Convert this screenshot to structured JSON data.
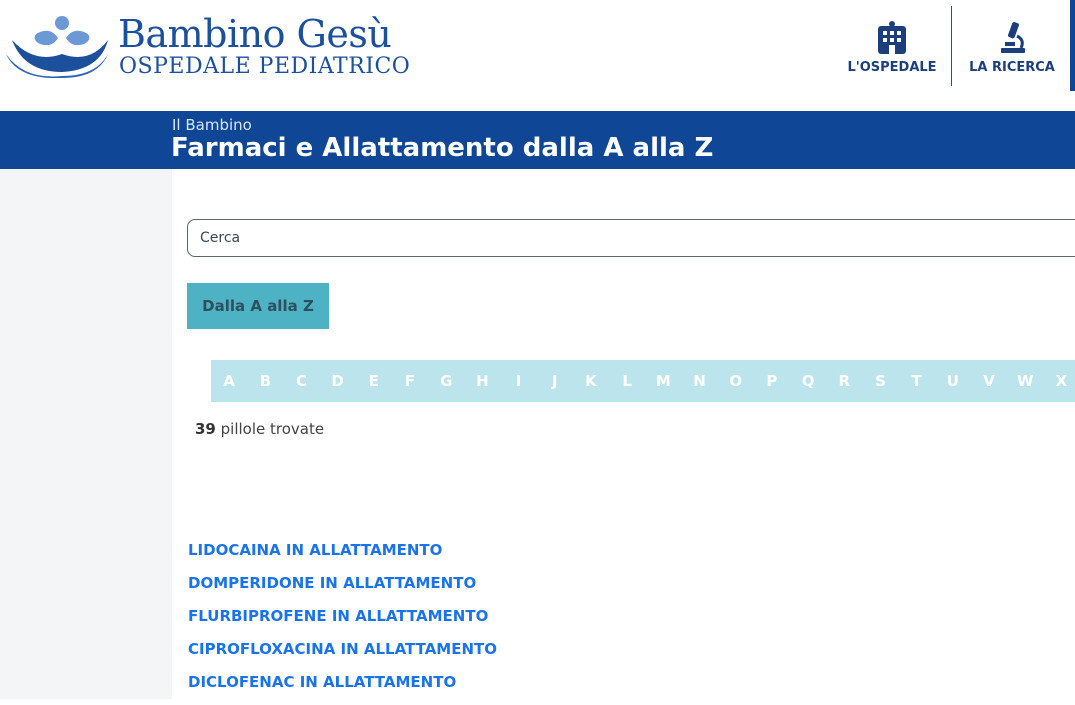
{
  "logo": {
    "title": "Bambino Gesù",
    "subtitle": "OSPEDALE PEDIATRICO",
    "icon": "bambino-gesu-emblem"
  },
  "nav": {
    "hospital": {
      "label": "L'OSPEDALE",
      "icon": "hospital-building-icon"
    },
    "research": {
      "label": "LA RICERCA",
      "icon": "microscope-icon"
    }
  },
  "banner": {
    "breadcrumb": "Il Bambino",
    "title": "Farmaci e Allattamento dalla A alla Z"
  },
  "search": {
    "placeholder": "Cerca",
    "value": ""
  },
  "tab": {
    "label": "Dalla A alla Z"
  },
  "alphabet": [
    "A",
    "B",
    "C",
    "D",
    "E",
    "F",
    "G",
    "H",
    "I",
    "J",
    "K",
    "L",
    "M",
    "N",
    "O",
    "P",
    "Q",
    "R",
    "S",
    "T",
    "U",
    "V",
    "W",
    "X"
  ],
  "results_info": {
    "count": "39",
    "label": "pillole trovate"
  },
  "results": [
    "LIDOCAINA IN ALLATTAMENTO",
    "DOMPERIDONE IN ALLATTAMENTO",
    "FLURBIPROFENE IN ALLATTAMENTO",
    "CIPROFLOXACINA IN ALLATTAMENTO",
    "DICLOFENAC IN ALLATTAMENTO"
  ],
  "colors": {
    "brand_blue": "#0f4796",
    "tab_teal": "#4db3c4",
    "alphabet_bar": "#bce4ec",
    "link_blue": "#1a73e8"
  }
}
